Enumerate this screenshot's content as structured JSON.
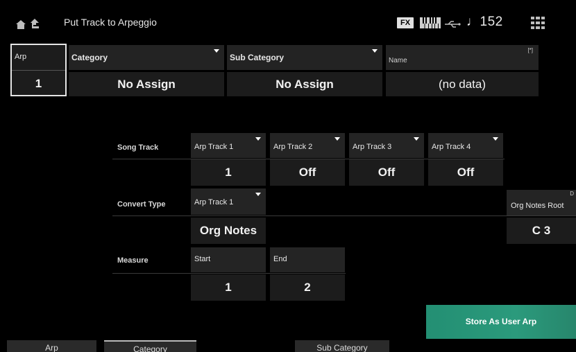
{
  "header": {
    "title": "Put Track to Arpeggio",
    "fx_label": "FX",
    "tempo": "♩152"
  },
  "top_row": {
    "arp": {
      "label": "Arp",
      "value": "1"
    },
    "category": {
      "label": "Category",
      "value": "No Assign"
    },
    "sub_category": {
      "label": "Sub Category",
      "value": "No Assign"
    },
    "name": {
      "label": "Name",
      "value": "(no data)",
      "edit_marker": "[*]"
    }
  },
  "song_track": {
    "label": "Song Track",
    "columns": [
      {
        "label": "Arp Track 1",
        "value": "1"
      },
      {
        "label": "Arp Track 2",
        "value": "Off"
      },
      {
        "label": "Arp Track 3",
        "value": "Off"
      },
      {
        "label": "Arp Track 4",
        "value": "Off"
      }
    ]
  },
  "convert_type": {
    "label": "Convert Type",
    "column": {
      "label": "Arp Track 1",
      "value": "Org Notes"
    },
    "org_notes_root": {
      "label": "Org Notes Root",
      "value": "C 3",
      "corner_marker": "D"
    }
  },
  "measure": {
    "label": "Measure",
    "start": {
      "label": "Start",
      "value": "1"
    },
    "end": {
      "label": "End",
      "value": "2"
    }
  },
  "store_button": {
    "label": "Store As User Arp"
  },
  "tabs": [
    {
      "label": "Arp"
    },
    {
      "label": "Category"
    },
    {
      "label": "Sub Category"
    }
  ]
}
